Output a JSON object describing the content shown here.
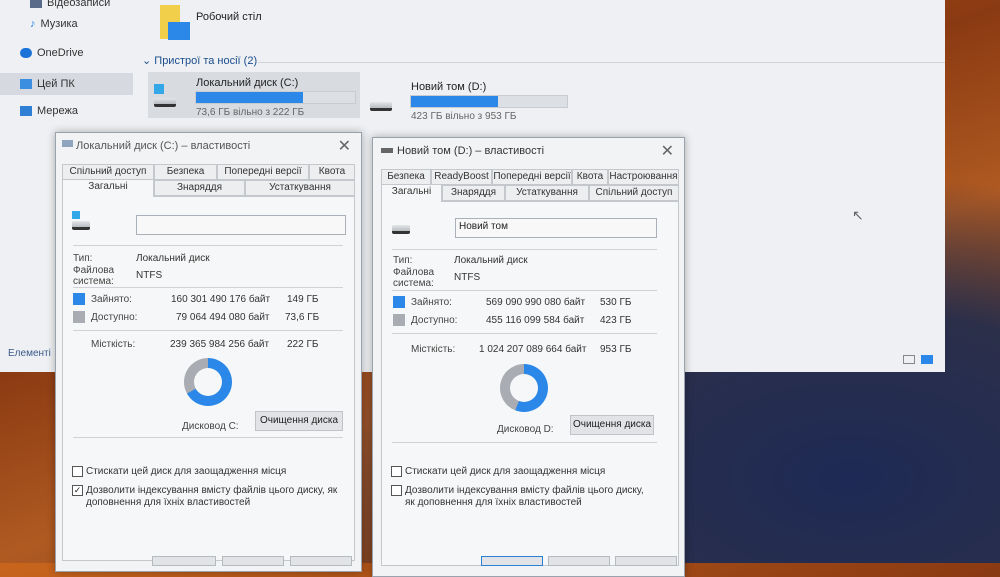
{
  "nav": {
    "items": [
      {
        "label": "Відеозаписи",
        "icon": "video-icon"
      },
      {
        "label": "Музика",
        "icon": "music-icon"
      },
      {
        "label": "OneDrive",
        "icon": "cloud-icon"
      },
      {
        "label": "Цей ПК",
        "icon": "computer-icon",
        "selected": true
      },
      {
        "label": "Мережа",
        "icon": "network-icon"
      }
    ]
  },
  "explorer": {
    "desktop_folder": "Робочий стіл",
    "section_header": "Пристрої та носії (2)",
    "status_text": "Елементі",
    "drives": [
      {
        "name": "Локальний диск (C:)",
        "free_text": "73,6 ГБ вільно з 222 ГБ",
        "used_percent": 67
      },
      {
        "name": "Новий том (D:)",
        "free_text": "423 ГБ вільно з 953 ГБ",
        "used_percent": 56
      }
    ]
  },
  "colors": {
    "used": "#2b88e8",
    "free": "#a9acb2"
  },
  "dialog_c": {
    "title": "Локальний диск (C:) – властивості",
    "tabs_row1": [
      "Спільний доступ",
      "Безпека",
      "Попередні версії",
      "Квота"
    ],
    "tabs_row2": [
      "Загальні",
      "Знаряддя",
      "Устаткування"
    ],
    "name_value": "",
    "type_label": "Тип:",
    "type_value": "Локальний диск",
    "fs_label": "Файлова система:",
    "fs_value": "NTFS",
    "used_label": "Зайнято:",
    "used_bytes": "160 301 490 176 байт",
    "used_size": "149 ГБ",
    "free_label": "Доступно:",
    "free_bytes": "79 064 494 080 байт",
    "free_size": "73,6 ГБ",
    "cap_label": "Місткість:",
    "cap_bytes": "239 365 984 256 байт",
    "cap_size": "222 ГБ",
    "used_percent": 67,
    "drive_label": "Дисковод C:",
    "cleanup": "Очищення диска",
    "compress": "Стискати цей диск для заощадження місця",
    "compress_checked": false,
    "index": "Дозволити індексування вмісту файлів цього диску, як доповнення для їхніх властивостей",
    "index_checked": true
  },
  "dialog_d": {
    "title": "Новий том (D:) – властивості",
    "tabs_row1": [
      "Безпека",
      "ReadyBoost",
      "Попередні версії",
      "Квота",
      "Настроювання"
    ],
    "tabs_row2": [
      "Загальні",
      "Знаряддя",
      "Устаткування",
      "Спільний доступ"
    ],
    "name_value": "Новий том",
    "type_label": "Тип:",
    "type_value": "Локальний диск",
    "fs_label": "Файлова система:",
    "fs_value": "NTFS",
    "used_label": "Зайнято:",
    "used_bytes": "569 090 990 080 байт",
    "used_size": "530 ГБ",
    "free_label": "Доступно:",
    "free_bytes": "455 116 099 584 байт",
    "free_size": "423 ГБ",
    "cap_label": "Місткість:",
    "cap_bytes": "1 024 207 089 664 байт",
    "cap_size": "953 ГБ",
    "used_percent": 56,
    "drive_label": "Дисковод D:",
    "cleanup": "Очищення диска",
    "compress": "Стискати цей диск для заощадження місця",
    "compress_checked": false,
    "index": "Дозволити індексування вмісту файлів цього диску, як доповнення для їхніх властивостей",
    "index_checked": false
  }
}
